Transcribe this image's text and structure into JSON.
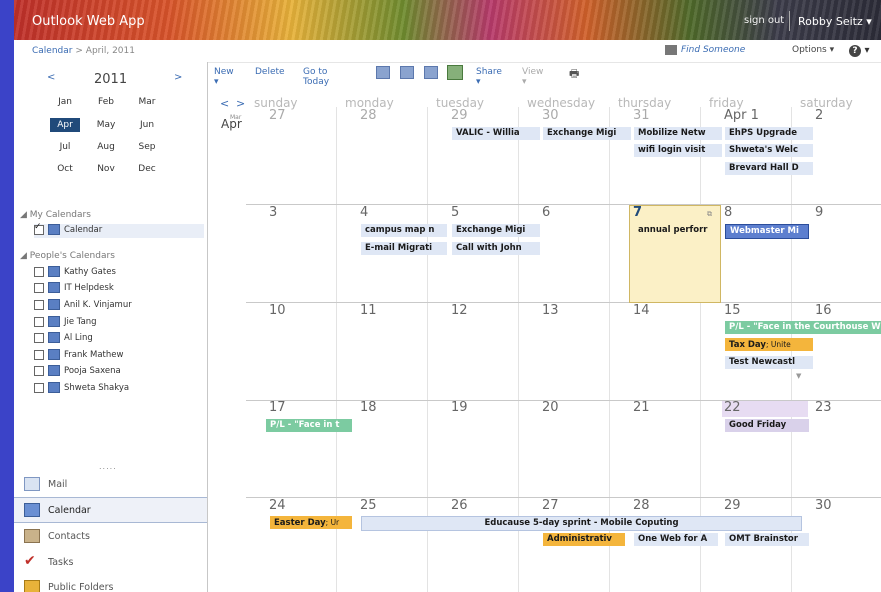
{
  "header": {
    "app_title": "Outlook Web App",
    "sign_out": "sign out",
    "user": "Robby Seitz"
  },
  "subheader": {
    "crumb_section": "Calendar",
    "crumb_sep": ">",
    "crumb_current": "April, 2011",
    "find_someone": "Find Someone",
    "options": "Options",
    "help": "?"
  },
  "minical": {
    "prev": "<",
    "next": ">",
    "year": "2011",
    "months": [
      "Jan",
      "Feb",
      "Mar",
      "Apr",
      "May",
      "Jun",
      "Jul",
      "Aug",
      "Sep",
      "Oct",
      "Nov",
      "Dec"
    ],
    "selected_month": "Apr"
  },
  "my_calendars": {
    "label": "My Calendars",
    "items": [
      {
        "label": "Calendar",
        "checked": true
      }
    ]
  },
  "peoples_calendars": {
    "label": "People's Calendars",
    "items": [
      {
        "label": "Kathy Gates"
      },
      {
        "label": "IT Helpdesk"
      },
      {
        "label": "Anil K. Vinjamur"
      },
      {
        "label": "Jie Tang"
      },
      {
        "label": "Al Ling"
      },
      {
        "label": "Frank Mathew"
      },
      {
        "label": "Pooja Saxena"
      },
      {
        "label": "Shweta Shakya"
      }
    ]
  },
  "nav": {
    "more": ".....",
    "items": [
      "Mail",
      "Calendar",
      "Contacts",
      "Tasks",
      "Public Folders"
    ]
  },
  "toolbar": {
    "new": "New",
    "delete": "Delete",
    "go_to_today": "Go to Today",
    "share": "Share",
    "view": "View"
  },
  "calendar": {
    "prev": "<",
    "next": ">",
    "month_label": "Apr",
    "month_small": "Mar",
    "days": [
      "sunday",
      "monday",
      "tuesday",
      "wednesday",
      "thursday",
      "friday",
      "saturday"
    ],
    "weeks": [
      [
        "27",
        "28",
        "29",
        "30",
        "31",
        "Apr 1",
        "2"
      ],
      [
        "3",
        "4",
        "5",
        "6",
        "7",
        "8",
        "9"
      ],
      [
        "10",
        "11",
        "12",
        "13",
        "14",
        "15",
        "16"
      ],
      [
        "17",
        "18",
        "19",
        "20",
        "21",
        "22",
        "23"
      ],
      [
        "24",
        "25",
        "26",
        "27",
        "28",
        "29",
        "30"
      ]
    ],
    "events": {
      "w1_tue": "VALIC - Willia",
      "w1_wed": "Exchange Migi",
      "w1_thu_a": "Mobilize Netw",
      "w1_thu_b": "wifi login visit",
      "w1_fri_a": "EhPS Upgrade",
      "w1_fri_b": "Shweta's Welc",
      "w1_fri_c": "Brevard Hall D",
      "w2_mon_a": "campus map n",
      "w2_mon_b": "E-mail Migrati",
      "w2_tue_a": "Exchange Migi",
      "w2_tue_b": "Call with John",
      "w2_thu": "annual perforr",
      "w2_fri": "Webmaster Mi",
      "w3_fri_green": "P/L - \"Face in the Courthouse W",
      "w3_fri_orange": "Tax Day",
      "w3_fri_orange_small": "; Unite",
      "w3_fri_blue": "Test Newcastl",
      "w4_sun": "P/L - \"Face in t",
      "w4_fri": "Good Friday",
      "w5_sun": "Easter Day",
      "w5_sun_small": "; Ur",
      "w5_span": "Educause 5-day sprint - Mobile Coputing",
      "w5_wed": "Administrativ",
      "w5_thu": "One Web for A",
      "w5_fri": "OMT Brainstor"
    }
  }
}
